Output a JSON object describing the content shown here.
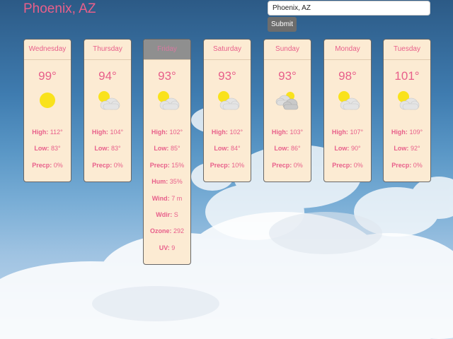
{
  "location": {
    "title": "Phoenix, AZ"
  },
  "search": {
    "value": "Phoenix, AZ",
    "submit_label": "Submit"
  },
  "days": [
    {
      "day": "Wednesday",
      "temp": "99°",
      "icon": "sun-icon",
      "selected": false,
      "stats": [
        {
          "label": "High:",
          "value": "112°"
        },
        {
          "label": "Low:",
          "value": "83°"
        },
        {
          "label": "Precp:",
          "value": "0%"
        }
      ]
    },
    {
      "day": "Thursday",
      "temp": "94°",
      "icon": "partly-cloudy-icon",
      "selected": false,
      "stats": [
        {
          "label": "High:",
          "value": "104°"
        },
        {
          "label": "Low:",
          "value": "83°"
        },
        {
          "label": "Precp:",
          "value": "0%"
        }
      ]
    },
    {
      "day": "Friday",
      "temp": "93°",
      "icon": "partly-cloudy-icon",
      "selected": true,
      "stats": [
        {
          "label": "High:",
          "value": "102°"
        },
        {
          "label": "Low:",
          "value": "85°"
        },
        {
          "label": "Precp:",
          "value": "15%"
        },
        {
          "label": "Hum:",
          "value": "35%"
        },
        {
          "label": "Wind:",
          "value": "7 m"
        },
        {
          "label": "Wdir:",
          "value": "S"
        },
        {
          "label": "Ozone:",
          "value": "292"
        },
        {
          "label": "UV:",
          "value": "9"
        }
      ]
    },
    {
      "day": "Saturday",
      "temp": "93°",
      "icon": "partly-cloudy-icon",
      "selected": false,
      "stats": [
        {
          "label": "High:",
          "value": "102°"
        },
        {
          "label": "Low:",
          "value": "84°"
        },
        {
          "label": "Precp:",
          "value": "10%"
        }
      ]
    },
    {
      "day": "Sunday",
      "temp": "93°",
      "icon": "cloudy-icon",
      "selected": false,
      "stats": [
        {
          "label": "High:",
          "value": "103°"
        },
        {
          "label": "Low:",
          "value": "86°"
        },
        {
          "label": "Precp:",
          "value": "0%"
        }
      ]
    },
    {
      "day": "Monday",
      "temp": "98°",
      "icon": "partly-cloudy-icon",
      "selected": false,
      "stats": [
        {
          "label": "High:",
          "value": "107°"
        },
        {
          "label": "Low:",
          "value": "90°"
        },
        {
          "label": "Precp:",
          "value": "0%"
        }
      ]
    },
    {
      "day": "Tuesday",
      "temp": "101°",
      "icon": "partly-cloudy-icon",
      "selected": false,
      "stats": [
        {
          "label": "High:",
          "value": "109°"
        },
        {
          "label": "Low:",
          "value": "92°"
        },
        {
          "label": "Precp:",
          "value": "0%"
        }
      ]
    }
  ],
  "colors": {
    "accent": "#e85f8a",
    "card_bg": "#fcebd3",
    "sun": "#f9e21c",
    "cloud": "#e4e4e4",
    "button": "#6d6d6d"
  }
}
